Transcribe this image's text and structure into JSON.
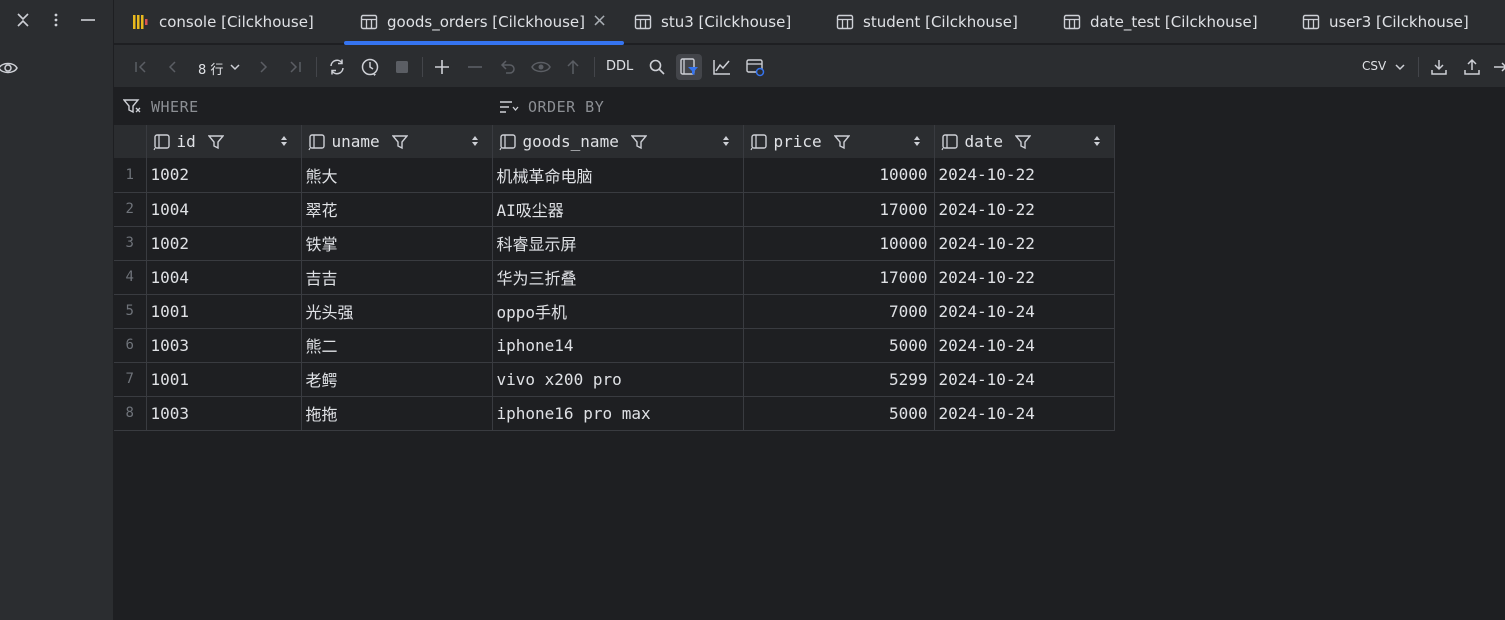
{
  "tabs": [
    {
      "label": "console [Cilckhouse]",
      "icon": "console-icon",
      "active": false
    },
    {
      "label": "goods_orders [Cilckhouse]",
      "icon": "table-icon",
      "active": true
    },
    {
      "label": "stu3 [Cilckhouse]",
      "icon": "table-icon",
      "active": false
    },
    {
      "label": "student [Cilckhouse]",
      "icon": "table-icon",
      "active": false
    },
    {
      "label": "date_test [Cilckhouse]",
      "icon": "table-icon",
      "active": false
    },
    {
      "label": "user3 [Cilckhouse]",
      "icon": "table-icon",
      "active": false
    }
  ],
  "toolbar": {
    "row_count": "8 行",
    "ddl_label": "DDL",
    "export_format": "CSV"
  },
  "filter": {
    "where_label": "WHERE",
    "order_by_label": "ORDER BY"
  },
  "accent_color": "#3574f0",
  "table": {
    "columns": [
      "id",
      "uname",
      "goods_name",
      "price",
      "date"
    ],
    "rows": [
      {
        "n": "1",
        "id": "1002",
        "uname": "熊大",
        "goods_name": "机械革命电脑",
        "price": "10000",
        "date": "2024-10-22"
      },
      {
        "n": "2",
        "id": "1004",
        "uname": "翠花",
        "goods_name": "AI吸尘器",
        "price": "17000",
        "date": "2024-10-22"
      },
      {
        "n": "3",
        "id": "1002",
        "uname": "铁掌",
        "goods_name": "科睿显示屏",
        "price": "10000",
        "date": "2024-10-22"
      },
      {
        "n": "4",
        "id": "1004",
        "uname": "吉吉",
        "goods_name": "华为三折叠",
        "price": "17000",
        "date": "2024-10-22"
      },
      {
        "n": "5",
        "id": "1001",
        "uname": "光头强",
        "goods_name": "oppo手机",
        "price": "7000",
        "date": "2024-10-24"
      },
      {
        "n": "6",
        "id": "1003",
        "uname": "熊二",
        "goods_name": "iphone14",
        "price": "5000",
        "date": "2024-10-24"
      },
      {
        "n": "7",
        "id": "1001",
        "uname": "老鳄",
        "goods_name": "vivo x200 pro",
        "price": "5299",
        "date": "2024-10-24"
      },
      {
        "n": "8",
        "id": "1003",
        "uname": "拖拖",
        "goods_name": "iphone16 pro max",
        "price": "5000",
        "date": "2024-10-24"
      }
    ]
  }
}
